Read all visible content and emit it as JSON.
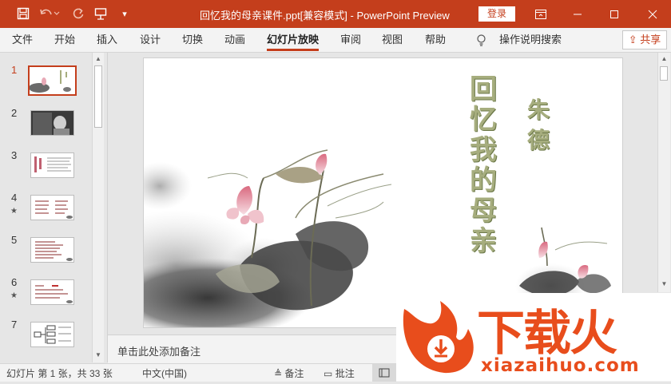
{
  "window": {
    "doc_title": "回忆我的母亲课件.ppt[兼容模式]  -  PowerPoint Preview",
    "login_label": "登录",
    "icons": [
      "save-icon",
      "undo-icon",
      "redo-icon",
      "present-icon",
      "customize-icon",
      "ribbon-display-icon",
      "minimize-icon",
      "maximize-icon",
      "close-icon"
    ]
  },
  "ribbon": {
    "tabs": [
      {
        "label": "文件",
        "active": false
      },
      {
        "label": "开始",
        "active": false
      },
      {
        "label": "插入",
        "active": false
      },
      {
        "label": "设计",
        "active": false
      },
      {
        "label": "切换",
        "active": false
      },
      {
        "label": "动画",
        "active": false
      },
      {
        "label": "幻灯片放映",
        "active": true
      },
      {
        "label": "审阅",
        "active": false
      },
      {
        "label": "视图",
        "active": false
      },
      {
        "label": "帮助",
        "active": false
      }
    ],
    "search_label": "操作说明搜索",
    "share_label": "共享"
  },
  "thumbnails": [
    {
      "num": "1",
      "star": ""
    },
    {
      "num": "2",
      "star": ""
    },
    {
      "num": "3",
      "star": ""
    },
    {
      "num": "4",
      "star": "★"
    },
    {
      "num": "5",
      "star": ""
    },
    {
      "num": "6",
      "star": "★"
    },
    {
      "num": "7",
      "star": ""
    }
  ],
  "slide": {
    "title": "回忆我的母亲",
    "author": "朱德"
  },
  "notes_placeholder": "单击此处添加备注",
  "status": {
    "slide_info": "幻灯片 第 1 张，共 33 张",
    "language": "中文(中国)",
    "notes_label": "备注",
    "comments_label": "批注"
  },
  "watermark": {
    "brand": "下载火",
    "url": "xiazaihuo.com"
  },
  "colors": {
    "accent": "#c43e1c",
    "watermark": "#e84d1c",
    "slide_text": "#a6ad7e"
  }
}
